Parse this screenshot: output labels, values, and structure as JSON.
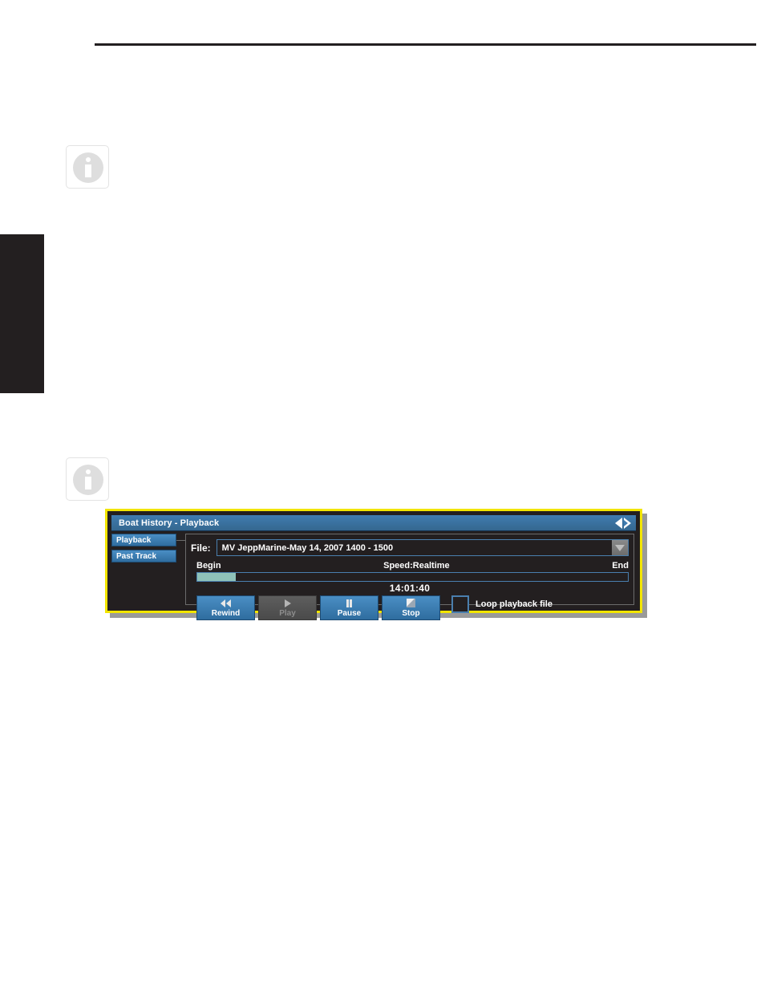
{
  "page": {
    "background_color": "#ffffff",
    "rule_color": "#231f20",
    "edge_tab": {
      "name": "chapter-edge-tab",
      "color": "#231f20"
    }
  },
  "notes": [
    {
      "icon": "info-icon",
      "id": "info-note-1"
    },
    {
      "icon": "info-icon",
      "id": "info-note-2"
    }
  ],
  "dialog": {
    "title": "Boat History - Playback",
    "border_color": "#f2e500",
    "titlebar_color": "#3f7cb0",
    "background_color": "#231f20",
    "nav": {
      "prev_icon": "triangle-left-icon",
      "next_icon": "triangle-right-icon"
    },
    "tabs": [
      {
        "label": "Playback",
        "selected": true
      },
      {
        "label": "Past Track",
        "selected": false
      }
    ],
    "file": {
      "label": "File:",
      "value": "MV JeppMarine-May 14, 2007 1400 - 1500",
      "dropdown_icon": "chevron-down-icon"
    },
    "scale": {
      "begin_label": "Begin",
      "speed_label": "Speed:Realtime",
      "end_label": "End"
    },
    "progress": {
      "percent": 9,
      "fill_color": "#8fc2b8",
      "track_border_color": "#4a7fae"
    },
    "time_display": "14:01:40",
    "transport": [
      {
        "label": "Rewind",
        "icon": "rewind-icon",
        "enabled": true
      },
      {
        "label": "Play",
        "icon": "play-icon",
        "enabled": false
      },
      {
        "label": "Pause",
        "icon": "pause-icon",
        "enabled": true
      },
      {
        "label": "Stop",
        "icon": "stop-icon",
        "enabled": true
      }
    ],
    "loop": {
      "label": "Loop playback file",
      "checked": false
    }
  }
}
